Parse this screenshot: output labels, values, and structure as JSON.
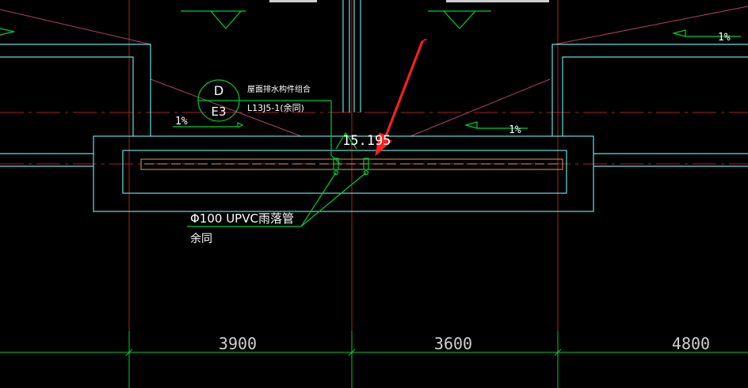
{
  "drawing": {
    "detail_symbol": {
      "top": "D",
      "bottom": "E3"
    },
    "annotation": {
      "title": "屋面排水构件组合",
      "reference": "L13J5-1(余同)"
    },
    "elevation": "15.195",
    "slopes": [
      "1%",
      "1%",
      "1%"
    ],
    "pipe_label": {
      "line1": "Φ100 UPVC雨落管",
      "line2": "余同"
    },
    "dimensions": [
      "3900",
      "3600",
      "4800"
    ]
  },
  "colors": {
    "background": "#000000",
    "wall": "#66dddd",
    "annotation_line": "#00cc33",
    "axis": "#aa2020",
    "text": "#ffffff",
    "dimension_text": "#cfcfcf",
    "pipe": "#d4a050",
    "highlight_arrow": "#ff2020"
  }
}
